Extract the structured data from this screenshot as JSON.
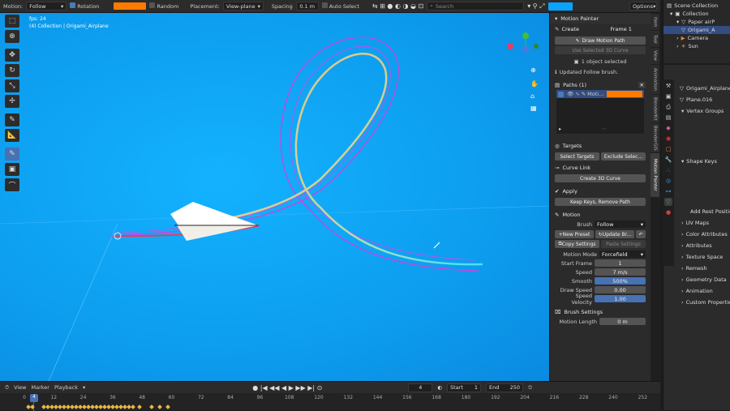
{
  "topbar": {
    "motion_label": "Motion:",
    "motion_value": "Follow",
    "rotation_label": "Rotation",
    "random_label": "Random",
    "placement_label": "Placement:",
    "placement_value": "View-plane",
    "spacing_label": "Spacing",
    "spacing_value": "0.1 m",
    "autoselect_label": "Auto Select",
    "search_placeholder": "Search",
    "options_label": "Options",
    "brush_color": "#ff7a00"
  },
  "viewport": {
    "fps": "fps: 24",
    "collection_line": "(4) Collection | Origami_Airplane"
  },
  "npanel": {
    "title": "Motion Painter",
    "create_label": "Create",
    "frame_value": "Frame 1",
    "draw_motion_path": "Draw Motion Path",
    "use_selected_curve": "Use Selected 3D Curve",
    "objects_selected": "1 object selected",
    "status_msg": "Updated Follow brush.",
    "paths_title": "Paths (1)",
    "path_item": "Moti...",
    "path_color": "#ff7a00",
    "targets_title": "Targets",
    "select_targets": "Select Targets",
    "exclude_select": "Exclude Selec...",
    "curve_link_title": "Curve Link",
    "create_3d_curve": "Create 3D Curve",
    "apply_title": "Apply",
    "keep_keys": "Keep Keys, Remove Path",
    "motion_title": "Motion",
    "brush_label": "Brush",
    "brush_value": "Follow",
    "new_preset": "New Preset",
    "update_br": "Update Br...",
    "copy_settings": "Copy Settings",
    "paste_settings": "Paste Settings",
    "motion_mode_label": "Motion Mode",
    "motion_mode_value": "Forcefield",
    "start_frame_label": "Start Frame",
    "start_frame_value": "1",
    "speed_label": "Speed",
    "speed_value": "7 m/s",
    "smooth_label": "Smooth",
    "smooth_value": "500%",
    "draw_speed_label": "Draw Speed",
    "draw_speed_value": "0.00",
    "speed_velocity_label": "Speed Velocity",
    "speed_velocity_value": "1.00",
    "brush_settings_title": "Brush Settings",
    "motion_length_label": "Motion Length",
    "motion_length_value": "0 m"
  },
  "vtabs": [
    "Item",
    "Tool",
    "View",
    "Animation",
    "BlenderKit",
    "BlenderGIS",
    "Motion Painter"
  ],
  "outliner": {
    "scene_collection": "Scene Collection",
    "collection": "Collection",
    "paper_airplane": "Paper airP",
    "origami": "Origami_A",
    "camera": "Camera",
    "sun": "Sun"
  },
  "properties": {
    "object_name": "Origami_Airplane",
    "mesh_name": "Plane.016",
    "vertex_groups": "Vertex Groups",
    "shape_keys": "Shape Keys",
    "add_rest_position": "Add Rest Position",
    "uv_maps": "UV Maps",
    "color_attributes": "Color Attributes",
    "attributes": "Attributes",
    "texture_space": "Texture Space",
    "remesh": "Remesh",
    "geometry_data": "Geometry Data",
    "animation": "Animation",
    "custom_properties": "Custom Properties"
  },
  "timeline": {
    "view": "View",
    "marker": "Marker",
    "playback": "Playback",
    "current_frame": "4",
    "start_label": "Start",
    "start_value": "1",
    "end_label": "End",
    "end_value": "250",
    "ticks": [
      "0",
      "12",
      "24",
      "36",
      "48",
      "60",
      "72",
      "84",
      "96",
      "108",
      "120",
      "132",
      "144",
      "156",
      "168",
      "180",
      "192",
      "204",
      "216",
      "228",
      "240",
      "252"
    ],
    "playhead": "4"
  }
}
